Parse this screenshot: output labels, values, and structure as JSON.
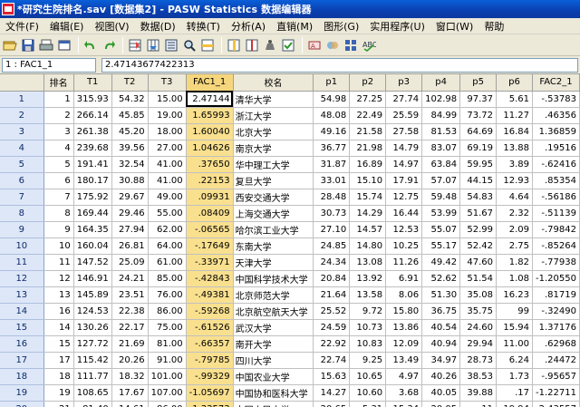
{
  "window": {
    "title": "*研究生院排名.sav [数据集2] - PASW Statistics 数据编辑器"
  },
  "menu": [
    "文件(F)",
    "编辑(E)",
    "视图(V)",
    "数据(D)",
    "转换(T)",
    "分析(A)",
    "直销(M)",
    "图形(G)",
    "实用程序(U)",
    "窗口(W)",
    "帮助"
  ],
  "toolbar": {
    "icons": [
      "open-icon",
      "save-icon",
      "print-icon",
      "dialog-recall-icon",
      "undo-icon",
      "redo-icon",
      "goto-case-icon",
      "goto-variable-icon",
      "variables-icon",
      "find-icon",
      "insert-cases-icon",
      "insert-variable-icon",
      "split-file-icon",
      "weight-cases-icon",
      "select-cases-icon",
      "value-labels-icon",
      "use-sets-icon",
      "show-all-icon",
      "spelling-icon"
    ]
  },
  "cell_editor": {
    "reference": "1 : FAC1_1",
    "value": "2.47143677422313"
  },
  "grid": {
    "columns": [
      "",
      "排名",
      "T1",
      "T2",
      "T3",
      "FAC1_1",
      "校名",
      "p1",
      "p2",
      "p3",
      "p4",
      "p5",
      "p6",
      "FAC2_1"
    ],
    "rows": [
      [
        "1",
        "1",
        "315.93",
        "54.32",
        "15.00",
        "2.47144",
        "清华大学",
        "54.98",
        "27.25",
        "27.74",
        "102.98",
        "97.37",
        "5.61",
        "-.53783"
      ],
      [
        "2",
        "2",
        "266.14",
        "45.85",
        "19.00",
        "1.65993",
        "浙江大学",
        "48.08",
        "22.49",
        "25.59",
        "84.99",
        "73.72",
        "11.27",
        ".46356"
      ],
      [
        "3",
        "3",
        "261.38",
        "45.20",
        "18.00",
        "1.60040",
        "北京大学",
        "49.16",
        "21.58",
        "27.58",
        "81.53",
        "64.69",
        "16.84",
        "1.36859"
      ],
      [
        "4",
        "4",
        "239.68",
        "39.56",
        "27.00",
        "1.04626",
        "南京大学",
        "36.77",
        "21.98",
        "14.79",
        "83.07",
        "69.19",
        "13.88",
        ".19516"
      ],
      [
        "5",
        "5",
        "191.41",
        "32.54",
        "41.00",
        ".37650",
        "华中理工大学",
        "31.87",
        "16.89",
        "14.97",
        "63.84",
        "59.95",
        "3.89",
        "-.62416"
      ],
      [
        "6",
        "6",
        "180.17",
        "30.88",
        "41.00",
        ".22153",
        "复旦大学",
        "33.01",
        "15.10",
        "17.91",
        "57.07",
        "44.15",
        "12.93",
        ".85354"
      ],
      [
        "7",
        "7",
        "175.92",
        "29.67",
        "49.00",
        ".09931",
        "西安交通大学",
        "28.48",
        "15.74",
        "12.75",
        "59.48",
        "54.83",
        "4.64",
        "-.56186"
      ],
      [
        "8",
        "8",
        "169.44",
        "29.46",
        "55.00",
        ".08409",
        "上海交通大学",
        "30.73",
        "14.29",
        "16.44",
        "53.99",
        "51.67",
        "2.32",
        "-.51139"
      ],
      [
        "9",
        "9",
        "164.35",
        "27.94",
        "62.00",
        "-.06565",
        "哈尔滨工业大学",
        "27.10",
        "14.57",
        "12.53",
        "55.07",
        "52.99",
        "2.09",
        "-.79842"
      ],
      [
        "10",
        "10",
        "160.04",
        "26.81",
        "64.00",
        "-.17649",
        "东南大学",
        "24.85",
        "14.80",
        "10.25",
        "55.17",
        "52.42",
        "2.75",
        "-.85264"
      ],
      [
        "11",
        "11",
        "147.52",
        "25.09",
        "61.00",
        "-.33971",
        "天津大学",
        "24.34",
        "13.08",
        "11.26",
        "49.42",
        "47.60",
        "1.82",
        "-.77938"
      ],
      [
        "12",
        "12",
        "146.91",
        "24.21",
        "85.00",
        "-.42843",
        "中国科学技术大学",
        "20.84",
        "13.92",
        "6.91",
        "52.62",
        "51.54",
        "1.08",
        "-1.20550"
      ],
      [
        "13",
        "13",
        "145.89",
        "23.51",
        "76.00",
        "-.49381",
        "北京师范大学",
        "21.64",
        "13.58",
        "8.06",
        "51.30",
        "35.08",
        "16.23",
        ".81719"
      ],
      [
        "14",
        "16",
        "124.53",
        "22.38",
        "86.00",
        "-.59268",
        "北京航空航天大学",
        "25.52",
        "9.72",
        "15.80",
        "36.75",
        "35.75",
        "99",
        "-.32490"
      ],
      [
        "15",
        "14",
        "130.26",
        "22.17",
        "75.00",
        "-.61526",
        "武汉大学",
        "24.59",
        "10.73",
        "13.86",
        "40.54",
        "24.60",
        "15.94",
        "1.37176"
      ],
      [
        "16",
        "15",
        "127.72",
        "21.69",
        "81.00",
        "-.66357",
        "南开大学",
        "22.92",
        "10.83",
        "12.09",
        "40.94",
        "29.94",
        "11.00",
        ".62968"
      ],
      [
        "17",
        "17",
        "115.42",
        "20.26",
        "91.00",
        "-.79785",
        "四川大学",
        "22.74",
        "9.25",
        "13.49",
        "34.97",
        "28.73",
        "6.24",
        ".24472"
      ],
      [
        "18",
        "18",
        "111.77",
        "18.32",
        "101.00",
        "-.99329",
        "中国农业大学",
        "15.63",
        "10.65",
        "4.97",
        "40.26",
        "38.53",
        "1.73",
        "-.95657"
      ],
      [
        "19",
        "19",
        "108.65",
        "17.67",
        "107.00",
        "-1.05697",
        "中国协和医科大学",
        "14.27",
        "10.60",
        "3.68",
        "40.05",
        "39.88",
        ".17",
        "-1.22711"
      ],
      [
        "20",
        "21",
        "81.40",
        "14.61",
        "86.00",
        "-1.33573",
        "中国人民大学",
        "20.65",
        "5.31",
        "15.34",
        "20.05",
        "11",
        "19.94",
        "2.43557"
      ]
    ]
  }
}
